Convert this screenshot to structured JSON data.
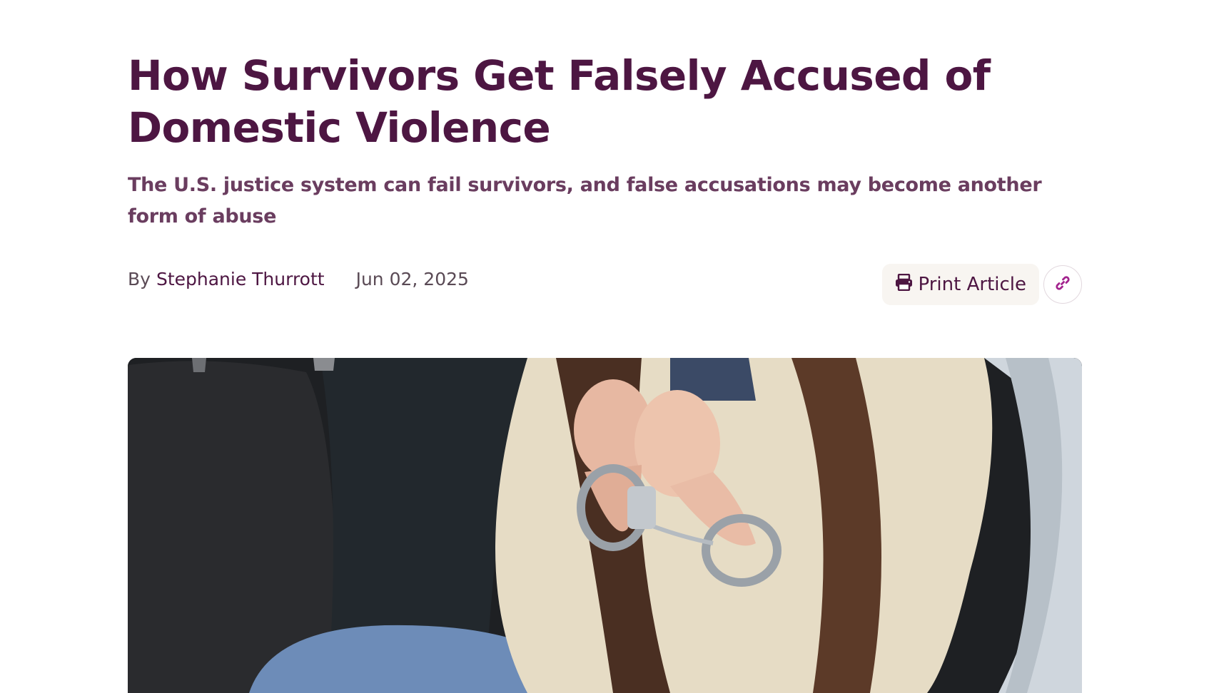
{
  "article": {
    "title": "How Survivors Get Falsely Accused of Domestic Violence",
    "subtitle": "The U.S. justice system can fail survivors, and false accusations may become another form of abuse",
    "byline_prefix": "By",
    "author": "Stephanie Thurrott",
    "date": "Jun 02, 2025"
  },
  "actions": {
    "print_label": "Print Article",
    "print_icon": "printer-icon",
    "copy_link_icon": "link-icon"
  },
  "hero_image": {
    "subject": "photo-handcuffed-hands"
  },
  "colors": {
    "title": "#4d1642",
    "subtitle": "#6a3d5f",
    "accent": "#a3238e",
    "button_bg": "#f8f5f1"
  }
}
